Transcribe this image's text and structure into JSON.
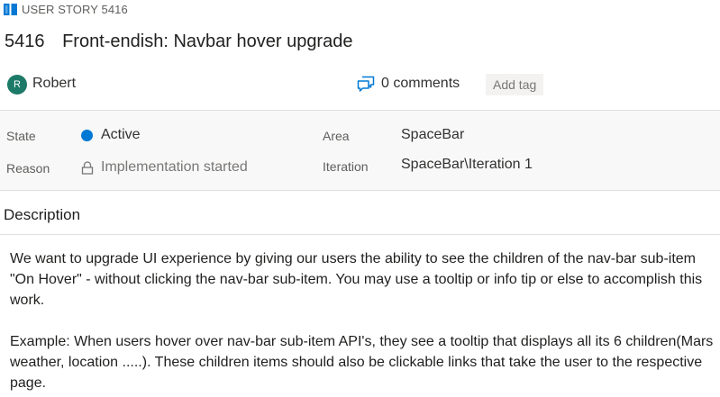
{
  "header": {
    "type_label": "USER STORY 5416",
    "type_icon": "book-icon",
    "type_color": "#0078d4",
    "work_item_id": "5416",
    "title": "Front-endish: Navbar hover upgrade"
  },
  "assignee": {
    "initial": "R",
    "name": "Robert",
    "avatar_color": "#1d7a68"
  },
  "comments": {
    "icon": "comments-icon",
    "label": "0 comments"
  },
  "tags": {
    "add_label": "Add tag"
  },
  "fields": {
    "state": {
      "label": "State",
      "value": "Active",
      "dot_color": "#0078d4"
    },
    "reason": {
      "label": "Reason",
      "value": "Implementation started",
      "icon": "lock-icon"
    },
    "area": {
      "label": "Area",
      "value": "SpaceBar"
    },
    "iteration": {
      "label": "Iteration",
      "value": "SpaceBar\\Iteration 1"
    }
  },
  "description": {
    "heading": "Description",
    "paragraphs": [
      "We want to upgrade UI experience by giving our users the ability to see the children of the nav-bar sub-item \"On Hover\" - without clicking the nav-bar sub-item. You may use a tooltip or info tip or else to accomplish this work.",
      "Example:  When users hover over nav-bar sub-item API's, they see a tooltip that displays all its 6 children(Mars weather, location .....). These children items should also be clickable links that take the user to the respective page."
    ]
  }
}
